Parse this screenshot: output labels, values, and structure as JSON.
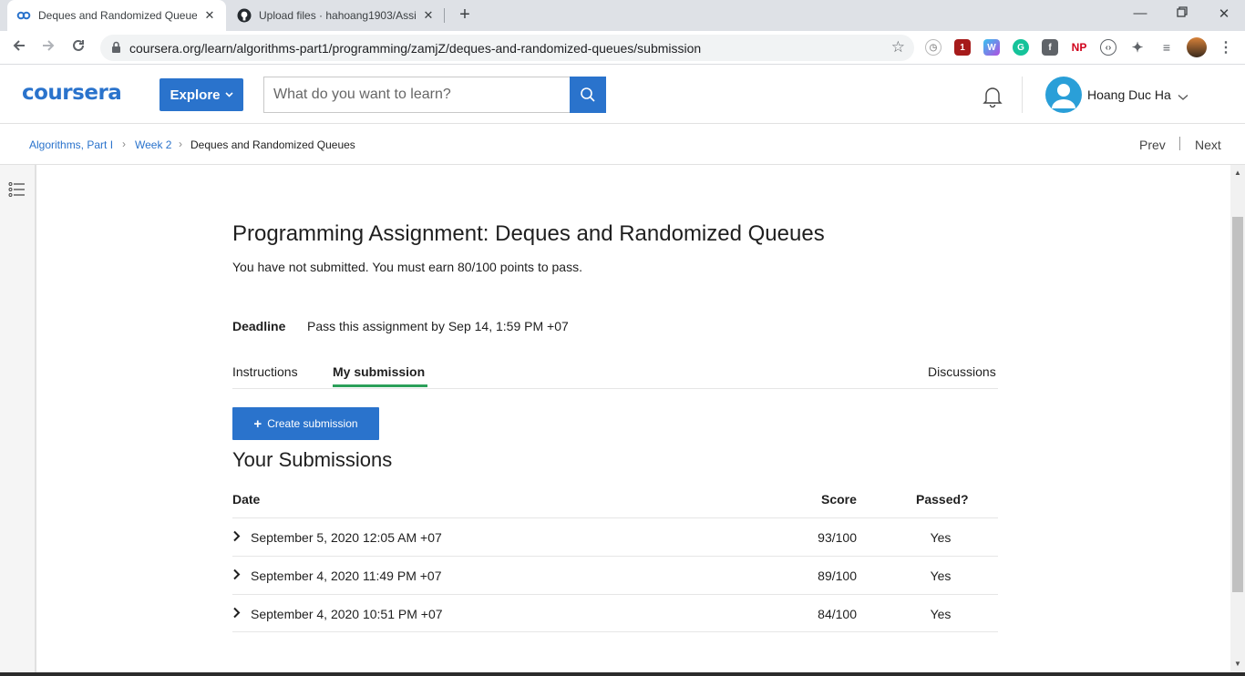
{
  "browser": {
    "tabs": [
      {
        "title": "Deques and Randomized Queues",
        "favicon": "coursera-icon",
        "active": true
      },
      {
        "title": "Upload files · hahoang1903/Assig",
        "favicon": "github-icon",
        "active": false
      }
    ],
    "url": "coursera.org/learn/algorithms-part1/programming/zamjZ/deques-and-randomized-queues/submission",
    "extensions": {
      "np_label": "NP",
      "badge_count": "1"
    }
  },
  "header": {
    "logo": "coursera",
    "explore_label": "Explore",
    "search_placeholder": "What do you want to learn?",
    "user_name": "Hoang Duc Ha"
  },
  "breadcrumb": {
    "items": [
      "Algorithms, Part I",
      "Week 2",
      "Deques and Randomized Queues"
    ],
    "prev": "Prev",
    "next": "Next"
  },
  "assignment": {
    "title": "Programming Assignment: Deques and Randomized Queues",
    "status": "You have not submitted. You must earn 80/100 points to pass.",
    "deadline_label": "Deadline",
    "deadline_value": "Pass this assignment by Sep 14, 1:59 PM +07"
  },
  "tabs": {
    "instructions": "Instructions",
    "my_submission": "My submission",
    "discussions": "Discussions"
  },
  "create_submission_label": "Create submission",
  "submissions": {
    "title": "Your Submissions",
    "headers": {
      "date": "Date",
      "score": "Score",
      "passed": "Passed?"
    },
    "rows": [
      {
        "date": "September 5, 2020 12:05 AM +07",
        "score": "93/100",
        "passed": "Yes"
      },
      {
        "date": "September 4, 2020 11:49 PM +07",
        "score": "89/100",
        "passed": "Yes"
      },
      {
        "date": "September 4, 2020 10:51 PM +07",
        "score": "84/100",
        "passed": "Yes"
      }
    ]
  },
  "colors": {
    "accent": "#2a73cc",
    "tab_underline": "#2ca05a"
  }
}
